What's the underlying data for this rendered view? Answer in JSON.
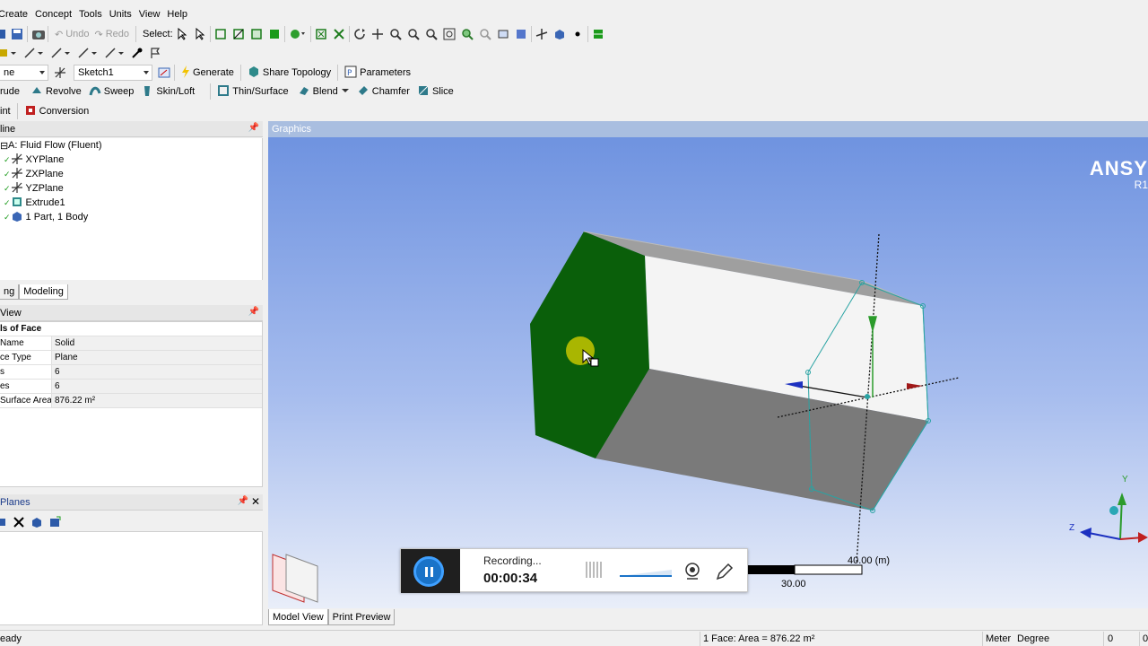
{
  "menu": [
    "Create",
    "Concept",
    "Tools",
    "Units",
    "View",
    "Help"
  ],
  "toolbar1": {
    "undo": "Undo",
    "redo": "Redo",
    "select_label": "Select:"
  },
  "toolbar3": {
    "plane_value": "ne",
    "sketch_value": "Sketch1",
    "generate": "Generate",
    "share_topology": "Share Topology",
    "parameters": "Parameters"
  },
  "toolbar4": {
    "extrude": "rude",
    "revolve": "Revolve",
    "sweep": "Sweep",
    "skin_loft": "Skin/Loft",
    "thin_surface": "Thin/Surface",
    "blend": "Blend",
    "chamfer": "Chamfer",
    "slice": "Slice"
  },
  "toolbar5": {
    "point": "int",
    "conversion": "Conversion"
  },
  "outline": {
    "header": "line",
    "items": [
      "A: Fluid Flow (Fluent)",
      "XYPlane",
      "ZXPlane",
      "YZPlane",
      "Extrude1",
      "1 Part, 1 Body"
    ]
  },
  "tabs": [
    "ng",
    "Modeling"
  ],
  "details": {
    "header": "View",
    "group": "ls of Face",
    "rows": [
      {
        "k": "Name",
        "v": "Solid"
      },
      {
        "k": "ce Type",
        "v": "Plane"
      },
      {
        "k": "s",
        "v": "6"
      },
      {
        "k": "es",
        "v": "6"
      },
      {
        "k": "Surface Area",
        "v": "876.22 m²"
      }
    ]
  },
  "planes": {
    "header": "Planes"
  },
  "graphics": {
    "header": "Graphics",
    "logo": "ANSY",
    "logo_sub": "R1",
    "scale_top": "40.00 (m)",
    "scale_bottom": "30.00",
    "axis_y": "Y",
    "axis_z": "Z"
  },
  "recorder": {
    "status": "Recording...",
    "time": "00:00:34"
  },
  "bottom_tabs": [
    "Model View",
    "Print Preview"
  ],
  "status": {
    "ready": "eady",
    "selection": "1 Face: Area = 876.22 m²",
    "unit_length": "Meter",
    "unit_angle": "Degree",
    "val1": "0",
    "val2": "0"
  },
  "colors": {
    "face_selected": "#0a5f0a",
    "face_white": "#f2f2f2",
    "face_gray": "#787878",
    "face_top": "#9f9f9f",
    "record_blue": "#1a73c8"
  }
}
